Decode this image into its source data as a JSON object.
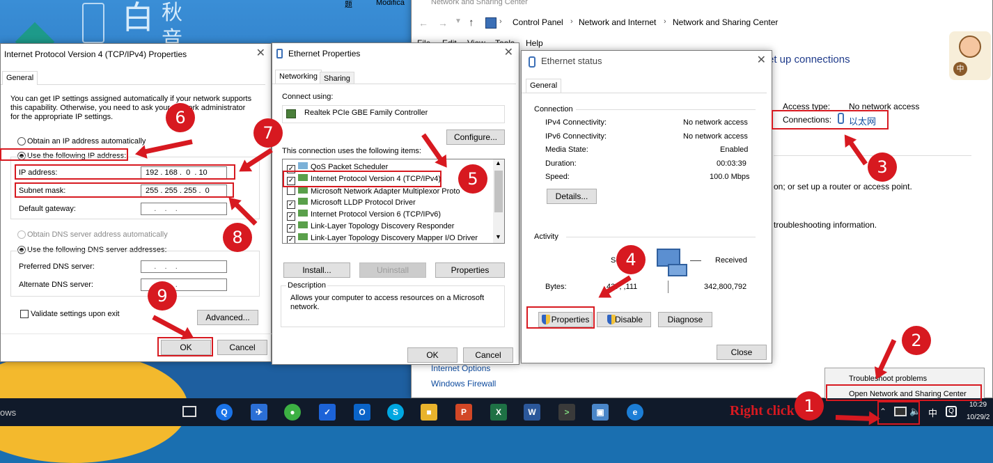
{
  "desktop": {
    "logo_chars": [
      "白",
      "秋",
      "音"
    ],
    "taskbar_left_text": "ows",
    "top_fragments": [
      "题",
      "Modifica"
    ]
  },
  "cp": {
    "title_partial": "Network and Sharing Center",
    "breadcrumb": [
      "Control Panel",
      "Network and Internet",
      "Network and Sharing Center"
    ],
    "menu": [
      "File",
      "Edit",
      "View",
      "Tools",
      "Help"
    ],
    "heading_partial": "et up connections",
    "access_type_label": "Access type:",
    "access_type_value": "No network access",
    "connections_label": "Connections:",
    "connections_value": "以太网",
    "text_router": "on; or set up a router or access point.",
    "text_troubleshoot": "troubleshooting information.",
    "link_internet_options": "Internet Options",
    "link_firewall": "Windows Firewall",
    "icon_hint": "中"
  },
  "ipv4": {
    "title": "Internet Protocol Version 4 (TCP/IPv4) Properties",
    "tab": "General",
    "intro": "You can get IP settings assigned automatically if your network supports this capability. Otherwise, you need to ask your network administrator for the appropriate IP settings.",
    "radio_auto": "Obtain an IP address automatically",
    "radio_manual": "Use the following IP address:",
    "ip_label": "IP address:",
    "ip_value": "192 . 168 .  0  . 10",
    "mask_label": "Subnet mask:",
    "mask_value": "255 . 255 . 255 .  0",
    "gateway_label": "Default gateway:",
    "gateway_value": "    .    .    .",
    "dns_auto": "Obtain DNS server address automatically",
    "dns_manual": "Use the following DNS server addresses:",
    "dns_pref_label": "Preferred DNS server:",
    "dns_alt_label": "Alternate DNS server:",
    "dns_empty": "    .    .    .",
    "validate": "Validate settings upon exit",
    "advanced": "Advanced...",
    "ok": "OK",
    "cancel": "Cancel"
  },
  "eth": {
    "title": "Ethernet Properties",
    "tabs": [
      "Networking",
      "Sharing"
    ],
    "connect_using": "Connect using:",
    "adapter": "Realtek PCIe GBE Family Controller",
    "configure": "Configure...",
    "items_label": "This connection uses the following items:",
    "items": [
      "QoS Packet Scheduler",
      "Internet Protocol Version 4 (TCP/IPv4)",
      "Microsoft Network Adapter Multiplexor Proto",
      "Microsoft LLDP Protocol Driver",
      "Internet Protocol Version 6 (TCP/IPv6)",
      "Link-Layer Topology Discovery Responder",
      "Link-Layer Topology Discovery Mapper I/O Driver"
    ],
    "install": "Install...",
    "uninstall": "Uninstall",
    "properties": "Properties",
    "description_label": "Description",
    "description": "Allows your computer to access resources on a Microsoft network.",
    "ok": "OK",
    "cancel": "Cancel"
  },
  "status": {
    "title": "Ethernet status",
    "tab": "General",
    "connection_label": "Connection",
    "rows": [
      {
        "label": "IPv4 Connectivity:",
        "value": "No network access"
      },
      {
        "label": "IPv6 Connectivity:",
        "value": "No network access"
      },
      {
        "label": "Media State:",
        "value": "Enabled"
      },
      {
        "label": "Duration:",
        "value": "00:03:39"
      },
      {
        "label": "Speed:",
        "value": "100.0 Mbps"
      }
    ],
    "details": "Details...",
    "activity_label": "Activity",
    "sent_partial": "Se",
    "received": "Received",
    "bytes_label": "Bytes:",
    "bytes_sent_partial": "437,   ,111",
    "bytes_received": "342,800,792",
    "properties": "Properties",
    "disable": "Disable",
    "diagnose": "Diagnose",
    "close": "Close"
  },
  "context_menu": {
    "items": [
      "Troubleshoot problems",
      "Open Network and Sharing Center"
    ]
  },
  "annotations": {
    "right_click": "Right click",
    "steps": [
      "1",
      "2",
      "3",
      "4",
      "5",
      "6",
      "7",
      "8",
      "9"
    ]
  },
  "taskbar": {
    "clock_time": "10:29",
    "clock_date": "10/29/2",
    "ime": "中"
  }
}
